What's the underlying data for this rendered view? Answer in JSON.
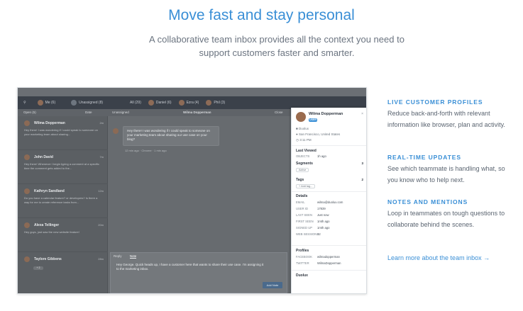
{
  "hero": {
    "title": "Move fast and stay personal",
    "subtitle": "A collaborative team inbox provides all the context you need to support customers faster and smarter."
  },
  "app": {
    "topbar": {
      "items": [
        "Me (6)",
        "Unassigned (8)",
        "All (29)",
        "Daniel (6)",
        "Ezra (4)",
        "Phil (3)"
      ]
    },
    "toolbar": {
      "filter": "Open (5)",
      "sort": "Date",
      "assignee": "Unassigned",
      "subject": "Wilma Dopperman",
      "close": "Close"
    },
    "conversations": [
      {
        "name": "Wilma Dopperman",
        "time": "2m",
        "preview": "Hey there! I was wondering if I could speak to someone on your marketing team about sharing..."
      },
      {
        "name": "John David",
        "time": "7m",
        "preview": "Hey there! Whenever I begin typing a comment at a specific time the comment gets added to the..."
      },
      {
        "name": "Kathryn Sandland",
        "time": "12m",
        "preview": "Do you have a calendar feature? or developers? Is there a way for me to create reference tasks from..."
      },
      {
        "name": "Alexa Tellinger",
        "time": "20m",
        "preview": "Hey guys, just saw the new website feature!"
      },
      {
        "name": "Taylore Gibbens",
        "time": "28m",
        "preview": "",
        "tag": "+ 2"
      }
    ],
    "message": {
      "text": "Hey there! I was wondering if I could speak to someone on your marketing team about sharing our use case on your blog?",
      "meta": "12 min ago · Chrome · 1 min ago"
    },
    "reply": {
      "tab_reply": "Reply",
      "tab_note": "Note",
      "text": "Hey George. Quick heads up, I have a customer here that wants to share their use case. I'm assigning it to the marketing inbox.",
      "send_label": "Add Note"
    },
    "profile": {
      "name": "Wilma Dopperman",
      "badge": "USER",
      "company": "Duolux",
      "location": "San Francisco, United States",
      "local_time": "3:11 PM",
      "last_viewed_label": "Last Viewed",
      "last_viewed_row": {
        "label": "OBJECTS",
        "value": "1h ago"
      },
      "segments_label": "Segments",
      "segments_count": "3",
      "segment_chip": "Active",
      "tags_label": "Tags",
      "tags_count": "2",
      "tag_chip": "+ Add tag...",
      "details_label": "Details",
      "details": [
        {
          "label": "EMAIL",
          "value": "wilma@duolux.com"
        },
        {
          "label": "USER ID",
          "value": "17839"
        },
        {
          "label": "LAST SEEN",
          "value": "Just now"
        },
        {
          "label": "FIRST SEEN",
          "value": "1mth ago"
        },
        {
          "label": "SIGNED UP",
          "value": "1mth ago"
        },
        {
          "label": "WEB SESSIONS",
          "value": "32"
        }
      ],
      "profiles_label": "Profiles",
      "profiles": [
        {
          "label": "FACEBOOK",
          "value": "wilmadopperman"
        },
        {
          "label": "TWITTER",
          "value": "WilmaDopperman"
        }
      ],
      "footer_company": "Duolux"
    }
  },
  "features": [
    {
      "heading": "LIVE CUSTOMER PROFILES",
      "text": "Reduce back-and-forth with relevant information like browser, plan and activity."
    },
    {
      "heading": "REAL-TIME UPDATES",
      "text": "See which teammate is handling what, so you know who to help next."
    },
    {
      "heading": "NOTES AND MENTIONS",
      "text": "Loop in teammates on tough questions to collaborate behind the scenes."
    }
  ],
  "learn_more": "Learn more about the team inbox →",
  "colors": {
    "accent": "#3a8fd6",
    "dark_bar": "#3b414a",
    "overlay": "#676b6f"
  }
}
